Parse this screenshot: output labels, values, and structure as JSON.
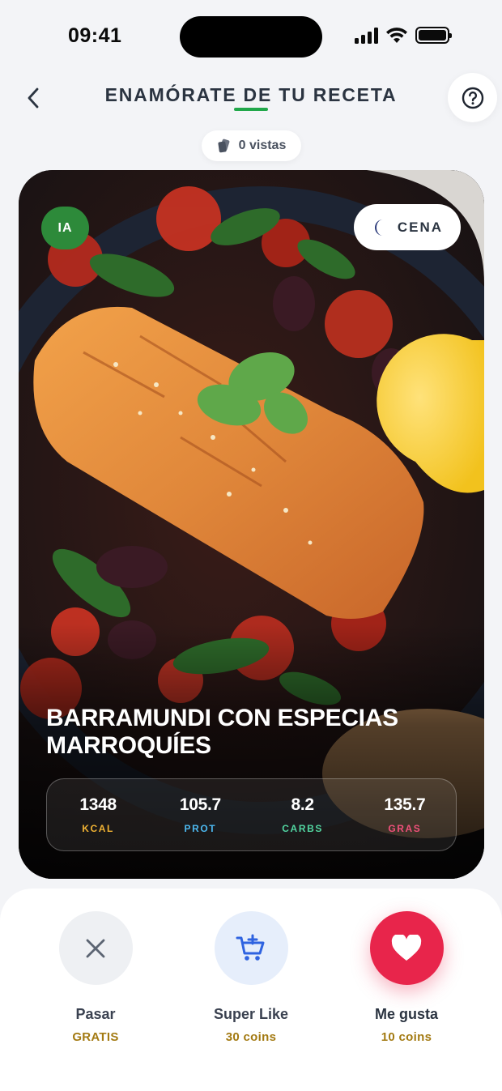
{
  "status_bar": {
    "time": "09:41"
  },
  "header": {
    "title": "ENAMÓRATE DE TU RECETA"
  },
  "views": {
    "label": "0 vistas"
  },
  "card": {
    "badge": "IA",
    "meal_type": "CENA",
    "recipe_title": "BARRAMUNDI CON ESPECIAS MARROQUÍES",
    "macros": [
      {
        "value": "1348",
        "label": "KCAL",
        "color": "#f0b233"
      },
      {
        "value": "105.7",
        "label": "PROT",
        "color": "#4cb8f0"
      },
      {
        "value": "8.2",
        "label": "CARBS",
        "color": "#52d6a0"
      },
      {
        "value": "135.7",
        "label": "GRAS",
        "color": "#f0507a"
      }
    ]
  },
  "actions": {
    "pass": {
      "label": "Pasar",
      "cost": "GRATIS"
    },
    "super_like": {
      "label": "Super Like",
      "cost": "30 coins"
    },
    "like": {
      "label": "Me gusta",
      "cost": "10 coins"
    }
  },
  "colors": {
    "accent_green": "#21a74a",
    "like_red": "#e8254b",
    "coin_gold": "#a37a12"
  }
}
